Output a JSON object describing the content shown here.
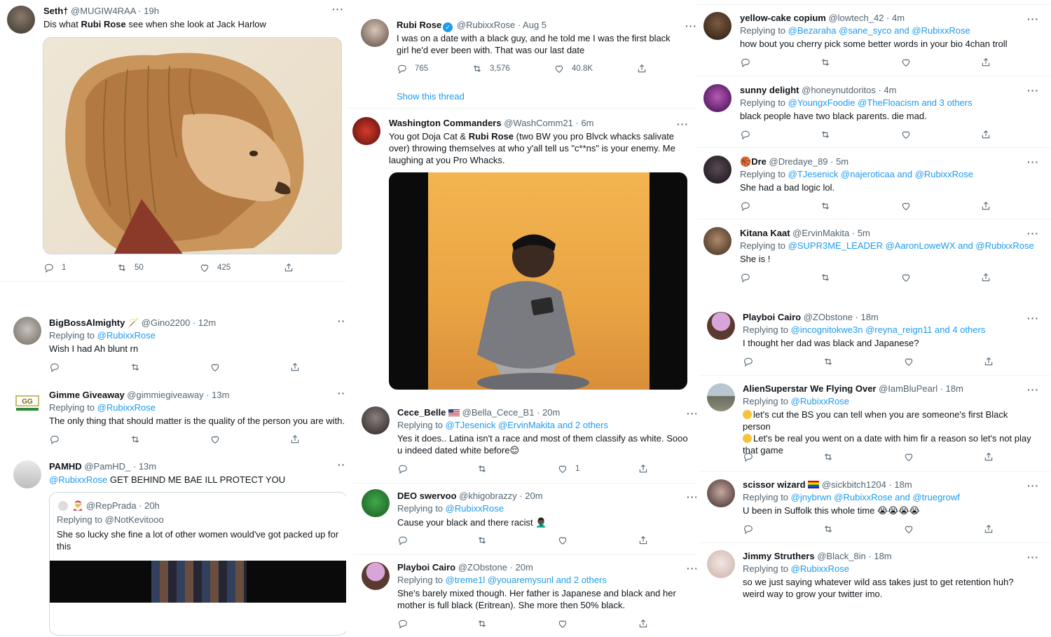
{
  "colors": {
    "accent": "#1d9bf0",
    "text": "#0f1419",
    "muted": "#536471",
    "divider": "#eff3f4"
  },
  "icons": {
    "reply": "reply-icon",
    "retweet": "retweet-icon",
    "like": "heart-icon",
    "share": "share-icon",
    "more": "more-icon"
  },
  "col1": {
    "t1": {
      "name": "Seth†",
      "handle": "@MUGIW4RAA · 19h",
      "text_pre": "Dis what ",
      "text_bold": "Rubi Rose",
      "text_post": " see when she look at Jack Harlow",
      "replies": "1",
      "retweets": "50",
      "likes": "425",
      "media_alt": "lion-with-dreadlocks-image"
    },
    "t2": {
      "name": "BigBossAlmighty",
      "handle": "@Gino2200 · 12m",
      "replying_label": "Replying to",
      "replying_to": "@RubixxRose",
      "text": "Wish I had Ah blunt rn"
    },
    "t3": {
      "name": "Gimme Giveaway",
      "handle": "@gimmiegiveaway · 13m",
      "replying_label": "Replying to",
      "replying_to": "@RubixxRose",
      "text": "The only thing that should matter is the quality of the person you are with."
    },
    "t4": {
      "name": "PAMHD",
      "handle": "@PamHD_ · 13m",
      "mention": "@RubixxRose",
      "text": " GET BEHIND ME BAE ILL PROTECT YOU",
      "quote": {
        "handle": "@RepPrada · 20h",
        "replying_label": "Replying to",
        "replying_to": "@NotKevitooo",
        "text": "She so lucky she fine a lot of other women would've got packed up for this"
      }
    }
  },
  "col2": {
    "t1": {
      "name": "Rubi Rose",
      "handle": "@RubixxRose · Aug 5",
      "text": "I was on a date with a black guy, and he told me I was the first black girl he'd ever been with. That was our last date",
      "replies": "765",
      "retweets": "3,576",
      "likes": "40.8K",
      "show_thread": "Show this thread"
    },
    "t2": {
      "name": "Washington Commanders",
      "handle": "@WashComm21 · 6m",
      "text_pre": "You got Doja Cat & ",
      "text_bold": "Rubi Rose",
      "text_post": " (two BW you pro Blvck whacks salivate over) throwing themselves at who y'all tell us \"c**ns\" is your enemy. Me laughing at you Pro Whacks."
    },
    "t3": {
      "name": "Cece_Belle",
      "handle": "@Bella_Cece_B1 · 20m",
      "replying_label": "Replying to",
      "replying_to": "@TJesenick @ErvinMakita and 2 others",
      "text": "Yes it does.. Latina isn't a race and most of them classify as white. Sooo u indeed dated white before😌",
      "likes": "1"
    },
    "t4": {
      "name": "DEO swervoo",
      "handle": "@khigobrazzy · 20m",
      "replying_label": "Replying to",
      "replying_to": "@RubixxRose",
      "text": "Cause your black and there racist 🤦🏿‍♂️"
    },
    "t5": {
      "name": "Playboi Cairo",
      "handle": "@ZObstone · 20m",
      "replying_label": "Replying to",
      "replying_to": "@treme1l @youaremysunl and 2 others",
      "text": "She's barely mixed though. Her father is Japanese and black and her mother is full black (Eritrean). She more then 50% black."
    }
  },
  "col3": {
    "t1": {
      "name": "yellow-cake copium",
      "handle": "@lowtech_42 · 4m",
      "replying_label": "Replying to",
      "replying_to": "@Bezaraha @sane_syco and @RubixxRose",
      "text": "how bout you cherry pick some better words in your bio 4chan troll"
    },
    "t2": {
      "name": "sunny delight",
      "handle": "@honeynutdoritos · 4m",
      "replying_label": "Replying to",
      "replying_to": "@YoungxFoodie @TheFloacism and 3 others",
      "text": "black people have two black parents. die mad."
    },
    "t3": {
      "name": "Dre",
      "handle": "@Dredaye_89 · 5m",
      "replying_label": "Replying to",
      "replying_to": "@TJesenick @najeroticaa and @RubixxRose",
      "text": "She had a bad logic lol."
    },
    "t4": {
      "name": "Kitana Kaat",
      "handle": "@ErvinMakita · 5m",
      "replying_label": "Replying to",
      "replying_to": "@SUPR3ME_LEADER @AaronLoweWX and @RubixxRose",
      "text": "She is !"
    },
    "t5": {
      "name": "Playboi Cairo",
      "handle": "@ZObstone · 18m",
      "replying_label": "Replying to",
      "replying_to": "@incognitokwe3n @reyna_reign11 and 4 others",
      "text": "I thought her dad was black and Japanese?"
    },
    "t6": {
      "name": "AlienSuperstar We Flying Over",
      "handle": "@IamBluPearl · 18m",
      "replying_label": "Replying to",
      "replying_to": "@RubixxRose",
      "line1": "let's cut the BS you can tell when you are someone's first Black person",
      "line2": "Let's be real you went on a date with him fir a reason so let's not play that game"
    },
    "t7": {
      "name": "scissor wizard",
      "handle": "@sickbitch1204 · 18m",
      "replying_label": "Replying to",
      "replying_to": "@jnybrwn @RubixxRose and @truegrowf",
      "text": "U been in Suffolk this whole time 😭😭😭😭"
    },
    "t8": {
      "name": "Jimmy Struthers",
      "handle": "@Black_8in · 18m",
      "replying_label": "Replying to",
      "replying_to": "@RubixxRose",
      "text": "so we just saying whatever wild ass takes just to get retention huh? weird way to grow your twitter imo."
    }
  }
}
